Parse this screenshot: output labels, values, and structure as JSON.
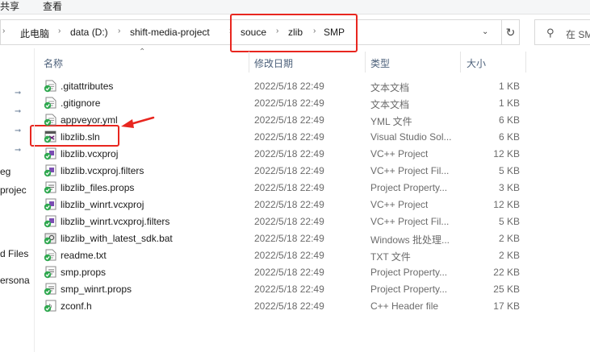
{
  "ribbon": {
    "tabs": [
      "共享",
      "查看"
    ]
  },
  "address": {
    "crumbs": [
      "此电脑",
      "data (D:)",
      "shift-media-project",
      "souce",
      "zlib",
      "SMP"
    ],
    "search_placeholder": "在 SM"
  },
  "nav": {
    "labels": [
      "eg",
      "projec",
      "d Files",
      "ersona"
    ]
  },
  "columns": {
    "name": "名称",
    "date": "修改日期",
    "type": "类型",
    "size": "大小"
  },
  "files": [
    {
      "name": ".gitattributes",
      "date": "2022/5/18 22:49",
      "type": "文本文档",
      "size": "1 KB",
      "icon": "text-file-icon"
    },
    {
      "name": ".gitignore",
      "date": "2022/5/18 22:49",
      "type": "文本文档",
      "size": "1 KB",
      "icon": "text-file-icon"
    },
    {
      "name": "appveyor.yml",
      "date": "2022/5/18 22:49",
      "type": "YML 文件",
      "size": "6 KB",
      "icon": "generic-file-icon"
    },
    {
      "name": "libzlib.sln",
      "date": "2022/5/18 22:49",
      "type": "Visual Studio Sol...",
      "size": "6 KB",
      "icon": "solution-file-icon"
    },
    {
      "name": "libzlib.vcxproj",
      "date": "2022/5/18 22:49",
      "type": "VC++ Project",
      "size": "12 KB",
      "icon": "project-file-icon"
    },
    {
      "name": "libzlib.vcxproj.filters",
      "date": "2022/5/18 22:49",
      "type": "VC++ Project Fil...",
      "size": "5 KB",
      "icon": "project-file-icon"
    },
    {
      "name": "libzlib_files.props",
      "date": "2022/5/18 22:49",
      "type": "Project Property...",
      "size": "3 KB",
      "icon": "props-file-icon"
    },
    {
      "name": "libzlib_winrt.vcxproj",
      "date": "2022/5/18 22:49",
      "type": "VC++ Project",
      "size": "12 KB",
      "icon": "project-file-icon"
    },
    {
      "name": "libzlib_winrt.vcxproj.filters",
      "date": "2022/5/18 22:49",
      "type": "VC++ Project Fil...",
      "size": "5 KB",
      "icon": "project-file-icon"
    },
    {
      "name": "libzlib_with_latest_sdk.bat",
      "date": "2022/5/18 22:49",
      "type": "Windows 批处理...",
      "size": "2 KB",
      "icon": "batch-file-icon"
    },
    {
      "name": "readme.txt",
      "date": "2022/5/18 22:49",
      "type": "TXT 文件",
      "size": "2 KB",
      "icon": "text-file-icon"
    },
    {
      "name": "smp.props",
      "date": "2022/5/18 22:49",
      "type": "Project Property...",
      "size": "22 KB",
      "icon": "props-file-icon"
    },
    {
      "name": "smp_winrt.props",
      "date": "2022/5/18 22:49",
      "type": "Project Property...",
      "size": "25 KB",
      "icon": "props-file-icon"
    },
    {
      "name": "zconf.h",
      "date": "2022/5/18 22:49",
      "type": "C++ Header file",
      "size": "17 KB",
      "icon": "header-file-icon"
    }
  ],
  "colors": {
    "annotation": "#e8261f",
    "sync_check": "#2fa84f",
    "header_text": "#4c607a"
  }
}
